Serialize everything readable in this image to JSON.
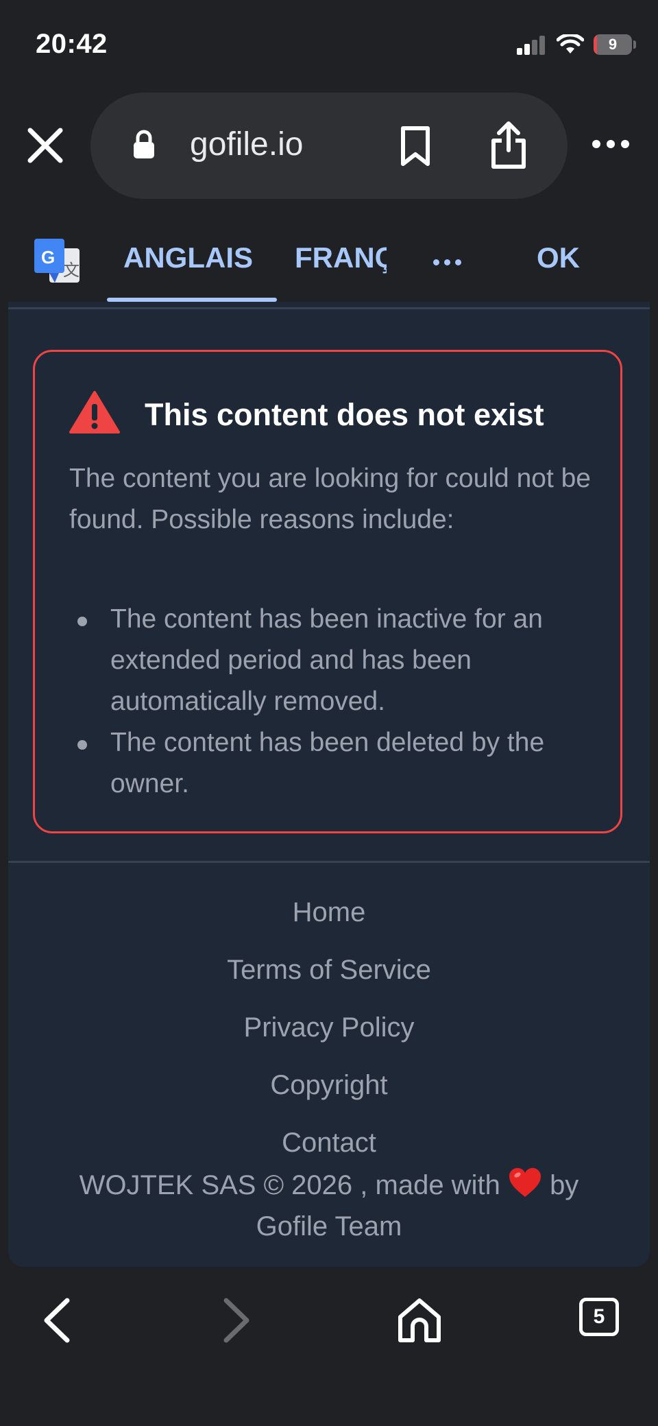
{
  "status_bar": {
    "time": "20:42",
    "battery_level": "9"
  },
  "browser": {
    "url": "gofile.io",
    "tabs_count": "5"
  },
  "translate_bar": {
    "tab_source": "ANGLAIS",
    "tab_target": "FRANÇAIS",
    "ok_label": "OK"
  },
  "alert": {
    "title": "This content does not exist",
    "description": "The content you are looking for could not be found. Possible reasons include:",
    "reasons": [
      "The content has been inactive for an extended period and has been automatically removed.",
      "The content has been deleted by the owner."
    ]
  },
  "footer": {
    "links": [
      "Home",
      "Terms of Service",
      "Privacy Policy",
      "Copyright",
      "Contact"
    ],
    "copyright_prefix": "WOJTEK SAS © 2026 , made with",
    "copyright_suffix": "by",
    "team": "Gofile Team"
  },
  "colors": {
    "accent_blue": "#a8c7fa",
    "alert_red": "#ef4444",
    "page_bg": "#1f2837",
    "chrome_bg": "#202124"
  },
  "icons": [
    "signal-icon",
    "wifi-icon",
    "battery-icon",
    "close-icon",
    "lock-icon",
    "bookmark-icon",
    "share-icon",
    "more-icon",
    "google-translate-icon",
    "warning-icon",
    "heart-icon",
    "back-icon",
    "forward-icon",
    "home-icon",
    "tabs-icon"
  ]
}
